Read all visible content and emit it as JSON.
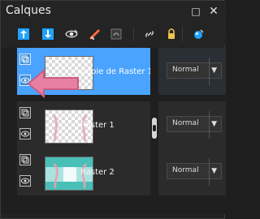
{
  "window": {
    "title": "Calques",
    "buttons": {
      "maximize_icon": "maximize-icon",
      "close_icon": "close-icon"
    }
  },
  "toolbar": {
    "icons": [
      "new-layer-up-icon",
      "new-layer-down-icon",
      "visibility-icon",
      "edit-icon",
      "mask-icon",
      "link-icon",
      "lock-icon",
      "color-picker-icon"
    ]
  },
  "layers": [
    {
      "name": "Copie de Raster 1",
      "selected": true,
      "blend": "Normal"
    },
    {
      "name": "Raster 1",
      "selected": false,
      "blend": "Normal"
    },
    {
      "name": "Raster 2",
      "selected": false,
      "blend": "Normal"
    }
  ],
  "colors": {
    "selected": "#4aa3ff",
    "panel": "#232323",
    "row": "#2b2b2b",
    "annotation_pink": "#e77fa2"
  }
}
